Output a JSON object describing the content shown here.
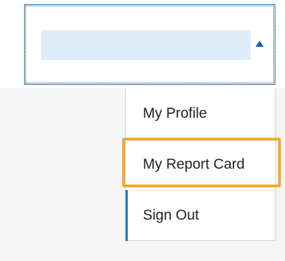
{
  "account_menu": {
    "user_name": "",
    "items": [
      {
        "label": "My Profile"
      },
      {
        "label": "My Report Card"
      },
      {
        "label": "Sign Out"
      }
    ]
  },
  "colors": {
    "accent": "#1a6fb4",
    "highlight": "#f2a92a",
    "name_bar": "#ddedf9",
    "background": "#f5f5f5"
  },
  "icons": {
    "caret": "caret-up-icon"
  }
}
